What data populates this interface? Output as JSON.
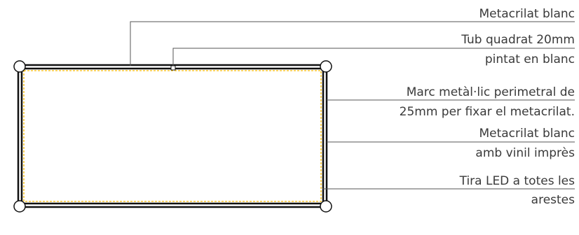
{
  "labels": {
    "metacrilat_top": "Metacrilat blanc",
    "tub_line1": "Tub quadrat 20mm",
    "tub_line2": "pintat en blanc",
    "marc_line1": "Marc metàl·lic perimetral de",
    "marc_line2": "25mm per fixar el metacrilat.",
    "vinil_line1": "Metacrilat blanc",
    "vinil_line2": "amb vinil imprès",
    "led_line1": "Tira LED a totes les",
    "led_line2": "arestes"
  },
  "colors": {
    "frame": "#111111",
    "led": "#f5b800",
    "leader": "#555555",
    "text": "#3a3a3a"
  }
}
